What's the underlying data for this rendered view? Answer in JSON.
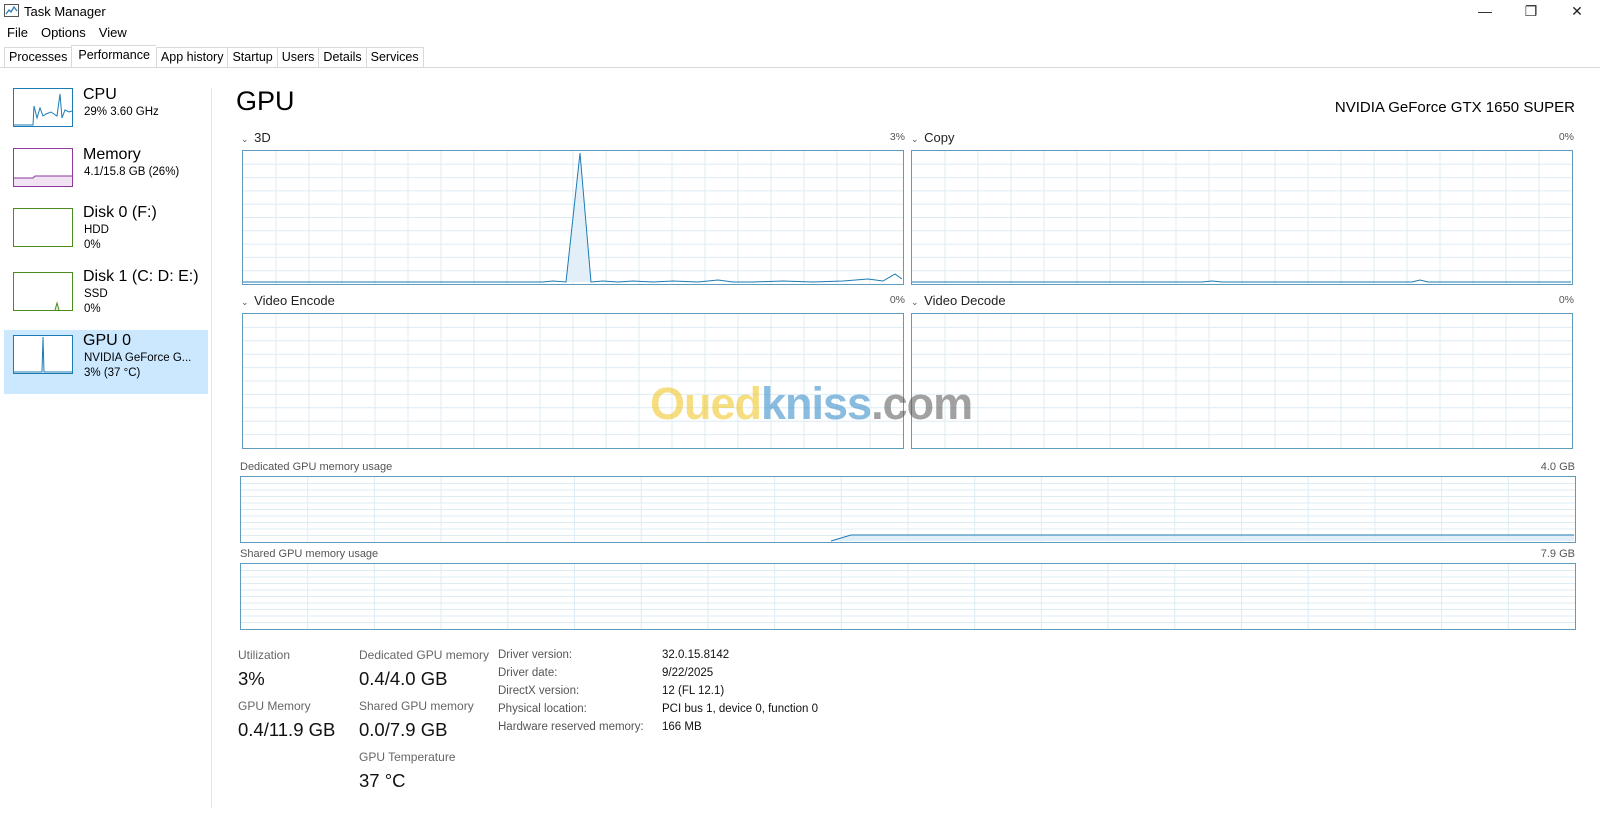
{
  "window": {
    "title": "Task Manager",
    "minimize_glyph": "—",
    "maximize_glyph": "❐",
    "close_glyph": "✕"
  },
  "menu": [
    "File",
    "Options",
    "View"
  ],
  "tabs": [
    "Processes",
    "Performance",
    "App history",
    "Startup",
    "Users",
    "Details",
    "Services"
  ],
  "active_tab": "Performance",
  "sidebar": {
    "items": [
      {
        "title": "CPU",
        "sub1": "29%  3.60 GHz",
        "sub2": "",
        "color": "#1c7bb5"
      },
      {
        "title": "Memory",
        "sub1": "4.1/15.8 GB (26%)",
        "sub2": "",
        "color": "#8e3a9b"
      },
      {
        "title": "Disk 0 (F:)",
        "sub1": "HDD",
        "sub2": "0%",
        "color": "#4c8c1f"
      },
      {
        "title": "Disk 1 (C: D: E:)",
        "sub1": "SSD",
        "sub2": "0%",
        "color": "#4c8c1f"
      },
      {
        "title": "GPU 0",
        "sub1": "NVIDIA GeForce G...",
        "sub2": "3% (37 °C)",
        "color": "#1c7bb5"
      }
    ],
    "selected": "GPU 0"
  },
  "main": {
    "title": "GPU",
    "model": "NVIDIA GeForce GTX 1650 SUPER",
    "engines": [
      {
        "label": "3D",
        "percent": "3%"
      },
      {
        "label": "Copy",
        "percent": "0%"
      },
      {
        "label": "Video Encode",
        "percent": "0%"
      },
      {
        "label": "Video Decode",
        "percent": "0%"
      }
    ],
    "dedicated_label": "Dedicated GPU memory usage",
    "dedicated_max": "4.0 GB",
    "shared_label": "Shared GPU memory usage",
    "shared_max": "7.9 GB"
  },
  "stats": {
    "utilization_label": "Utilization",
    "utilization_value": "3%",
    "gpu_memory_label": "GPU Memory",
    "gpu_memory_value": "0.4/11.9 GB",
    "dedicated_label": "Dedicated GPU memory",
    "dedicated_value": "0.4/4.0 GB",
    "shared_label": "Shared GPU memory",
    "shared_value": "0.0/7.9 GB",
    "temp_label": "GPU Temperature",
    "temp_value": "37 °C"
  },
  "details": [
    {
      "key": "Driver version:",
      "value": "32.0.15.8142"
    },
    {
      "key": "Driver date:",
      "value": "9/22/2025"
    },
    {
      "key": "DirectX version:",
      "value": "12 (FL 12.1)"
    },
    {
      "key": "Physical location:",
      "value": "PCI bus 1, device 0, function 0"
    },
    {
      "key": "Hardware reserved memory:",
      "value": "166 MB"
    }
  ],
  "watermark": {
    "part1": "Oued",
    "part2": "kniss",
    "part3": ".com"
  },
  "colors": {
    "gpu_line": "#1c7bb5",
    "graph_border": "#5f9bbd",
    "grid": "#dcecf4",
    "selected_bg": "#cce8ff"
  }
}
